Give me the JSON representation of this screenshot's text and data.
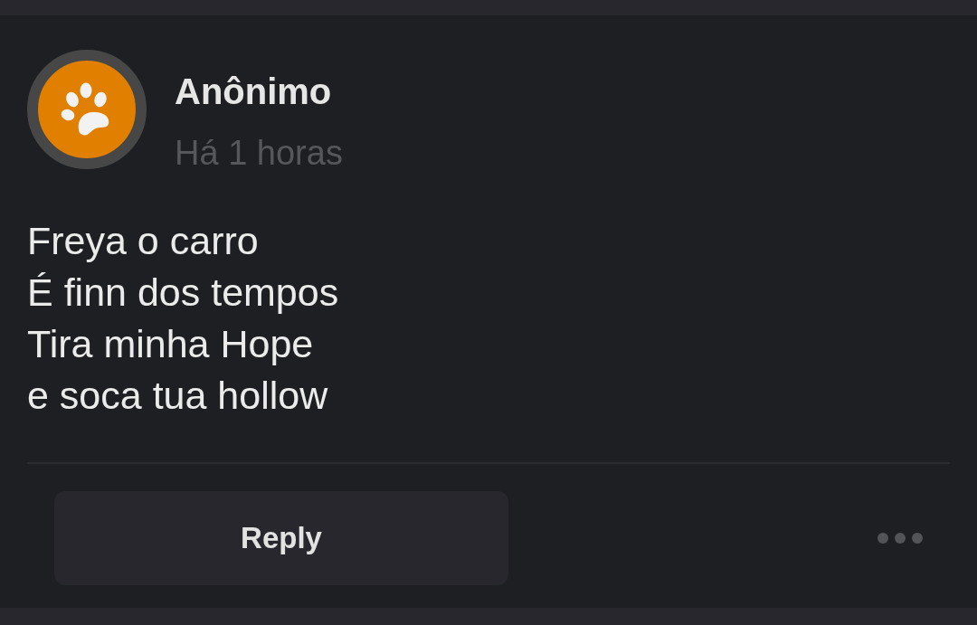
{
  "post": {
    "author": "Anônimo",
    "time": "Há 1 horas",
    "body": "Freya o carro\nÉ finn dos tempos\nTira minha Hope\ne soca tua hollow"
  },
  "actions": {
    "reply": "Reply"
  }
}
